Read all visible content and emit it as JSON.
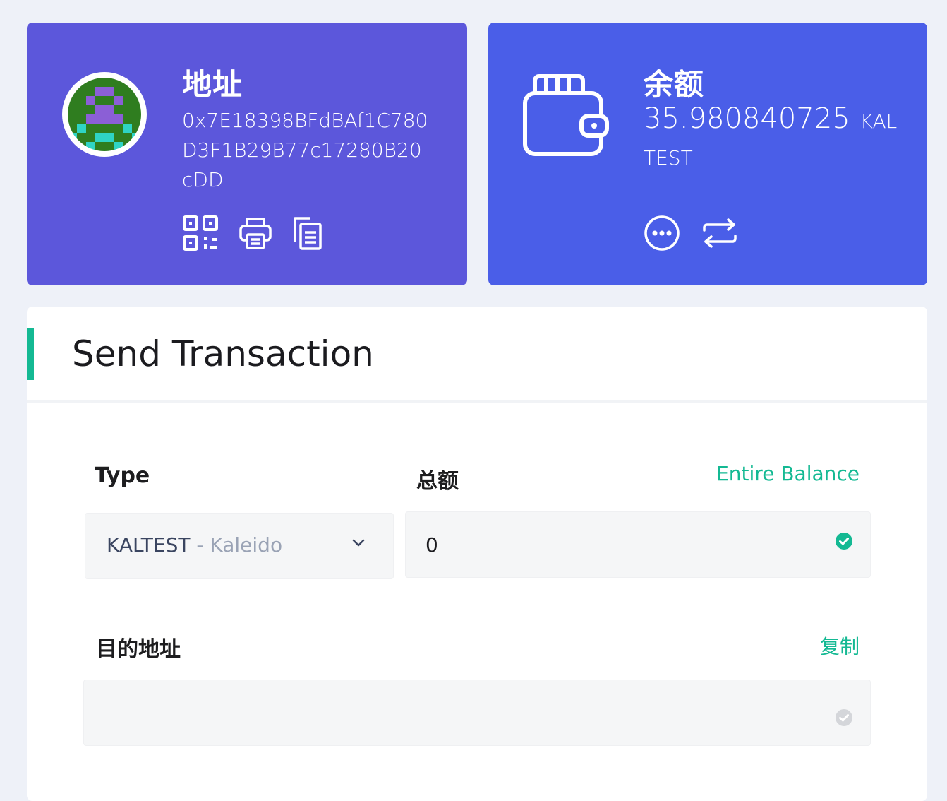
{
  "address_card": {
    "title": "地址",
    "address": "0x7E18398BFdBAf1C780D3F1B29B77c17280B20cDD",
    "icons": [
      "qr-code-icon",
      "printer-icon",
      "copy-icon"
    ],
    "background": "#5c57db"
  },
  "balance_card": {
    "title": "余额",
    "amount": "35.980840725",
    "unit": "KAL TEST",
    "icons": [
      "more-icon",
      "swap-icon"
    ],
    "background": "#4a5ee8"
  },
  "send_panel": {
    "title": "Send Transaction",
    "accent_color": "#14b993",
    "type_label": "Type",
    "type_select": {
      "value": "KALTEST",
      "separator": " - ",
      "network": "Kaleido"
    },
    "amount_label": "总额",
    "entire_balance_link": "Entire Balance",
    "amount_value": "0",
    "destination_label": "目的地址",
    "paste_link": "复制",
    "destination_value": ""
  }
}
